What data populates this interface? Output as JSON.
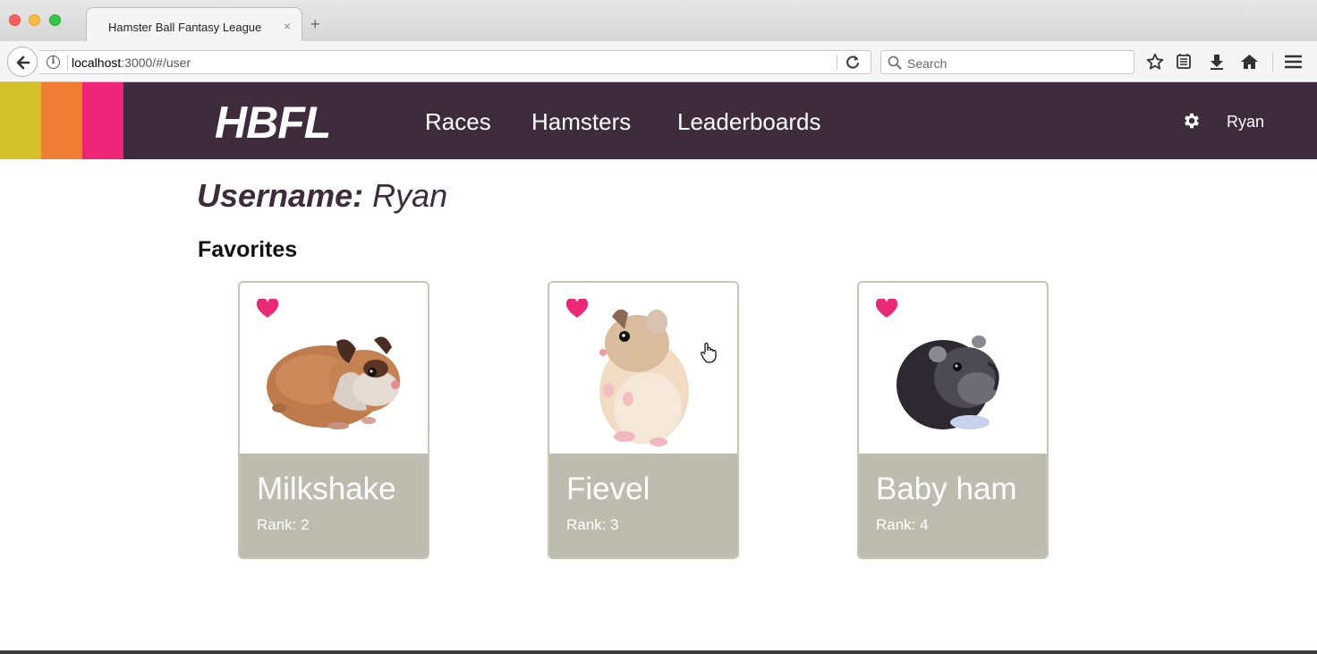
{
  "browser": {
    "tab_title": "Hamster Ball Fantasy League",
    "tab_close": "×",
    "new_tab": "+",
    "url_host": "localhost",
    "url_path": ":3000/#/user",
    "search_placeholder": "Search"
  },
  "app": {
    "logo": "HBFL",
    "nav": [
      "Races",
      "Hamsters",
      "Leaderboards"
    ],
    "user": "Ryan",
    "brand_colors": [
      "#d4c02a",
      "#f07d34",
      "#ef2577"
    ],
    "header_bg": "#3e2b3c"
  },
  "profile": {
    "username_label": "Username:",
    "username_value": "Ryan",
    "favorites_heading": "Favorites"
  },
  "favorites": [
    {
      "name": "Milkshake",
      "rank": "Rank: 2",
      "icon": "heart-icon"
    },
    {
      "name": "Fievel",
      "rank": "Rank: 3",
      "icon": "heart-icon"
    },
    {
      "name": "Baby ham",
      "rank": "Rank: 4",
      "icon": "heart-icon"
    }
  ]
}
